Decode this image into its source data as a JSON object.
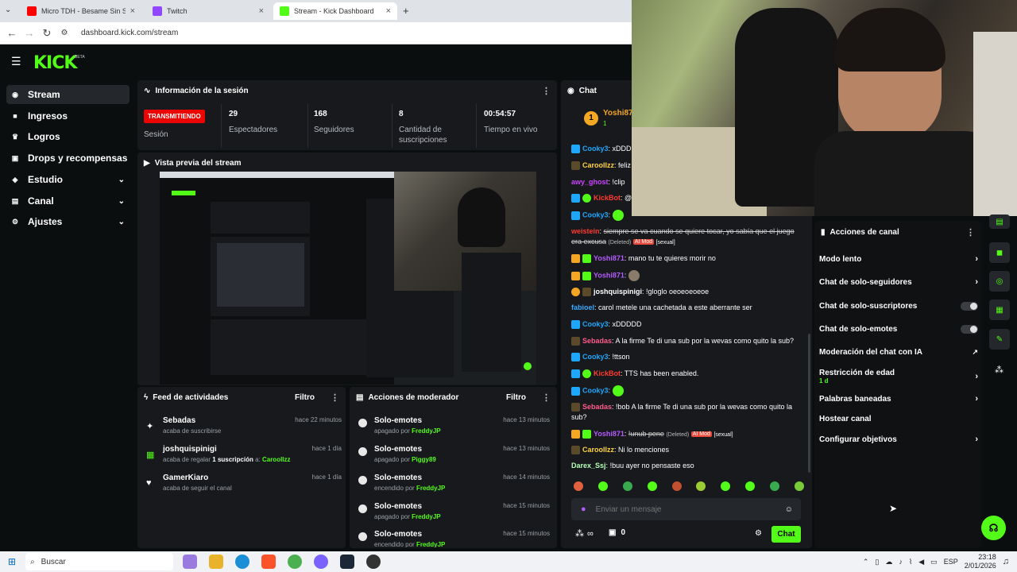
{
  "browser": {
    "tabs": [
      {
        "title": "Micro TDH - Besame Sin Sentir",
        "color": "#ff0000"
      },
      {
        "title": "Twitch",
        "color": "#9146ff"
      },
      {
        "title": "Stream - Kick Dashboard",
        "color": "#53fc18"
      }
    ],
    "new_tab": "+",
    "url": "dashboard.kick.com/stream"
  },
  "kick": {
    "logo": "KICK",
    "beta": "BETA",
    "sidebar": [
      {
        "label": "Stream",
        "icon": "pulse-icon",
        "active": true
      },
      {
        "label": "Ingresos",
        "icon": "money-icon"
      },
      {
        "label": "Logros",
        "icon": "trophy-icon"
      },
      {
        "label": "Drops y recompensas",
        "icon": "gift-icon"
      },
      {
        "label": "Estudio",
        "icon": "studio-icon",
        "expandable": true
      },
      {
        "label": "Canal",
        "icon": "channel-icon",
        "expandable": true
      },
      {
        "label": "Ajustes",
        "icon": "gear-icon",
        "expandable": true
      }
    ]
  },
  "session": {
    "title": "Información de la sesión",
    "live_badge": "TRANSMITIENDO",
    "session_label": "Sesión",
    "stats": [
      {
        "value": "29",
        "label": "Espectadores"
      },
      {
        "value": "168",
        "label": "Seguidores"
      },
      {
        "value": "8",
        "label": "Cantidad de suscripciones"
      },
      {
        "value": "00:54:57",
        "label": "Tiempo en vivo"
      }
    ]
  },
  "preview": {
    "title": "Vista previa del stream"
  },
  "activity": {
    "title": "Feed de actividades",
    "filter": "Filtro",
    "items": [
      {
        "name": "Sebadas",
        "desc": "acaba de suscribirse",
        "time": "hace 22 minutos",
        "icon": "sparkle-icon"
      },
      {
        "name": "joshquispinigi",
        "desc": "acaba de regalar ",
        "desc_bold": "1 suscripción",
        "desc_end": " a: ",
        "target": "Caroollzz",
        "time": "hace 1 día",
        "icon": "gift-sub-icon"
      },
      {
        "name": "GamerKiaro",
        "desc": "acaba de seguir el canal",
        "time": "hace 1 día",
        "icon": "heart-icon"
      }
    ]
  },
  "mod": {
    "title": "Acciones de moderador",
    "filter": "Filtro",
    "items": [
      {
        "name": "Solo-emotes",
        "state": "apagado por ",
        "mod": "FreddyJP",
        "time": "hace 13 minutos"
      },
      {
        "name": "Solo-emotes",
        "state": "apagado por ",
        "mod": "Piggy89",
        "time": "hace 13 minutos"
      },
      {
        "name": "Solo-emotes",
        "state": "encendido por ",
        "mod": "FreddyJP",
        "time": "hace 14 minutos"
      },
      {
        "name": "Solo-emotes",
        "state": "apagado por ",
        "mod": "FreddyJP",
        "time": "hace 15 minutos"
      },
      {
        "name": "Solo-emotes",
        "state": "encendido por ",
        "mod": "FreddyJP",
        "time": "hace 15 minutos"
      }
    ]
  },
  "chat": {
    "title": "Chat",
    "pinned_user": "Yoshi87",
    "pinned_count": "1",
    "messages": [
      {
        "user": "Cooky3",
        "color": "#1ea7ff",
        "text": "xDDDD"
      },
      {
        "user": "Caroollzz",
        "color": "#ffd43b",
        "text": "feliz"
      },
      {
        "user": "awy_ghost",
        "color": "#cc44ff",
        "text": "!clip"
      },
      {
        "user": "KickBot",
        "color": "#ff3b30",
        "text": "@"
      },
      {
        "user": "Cooky3",
        "color": "#1ea7ff",
        "text": ""
      },
      {
        "user": "weistein",
        "color": "#ff3b30",
        "text": "siempre se va cuando se quiere tocar, yo sabía que el juego era excusa",
        "deleted": "(Deleted)",
        "ai": "AI Mod",
        "reason": "[sexual]"
      },
      {
        "user": "Yoshi871",
        "color": "#b45cff",
        "text": "mano tu te quieres morir no"
      },
      {
        "user": "Yoshi871",
        "color": "#b45cff",
        "text": ""
      },
      {
        "user": "joshquispinigi",
        "color": "#ffffff",
        "text": "!gloglo oeoeoeoeoe"
      },
      {
        "user": "fabioel",
        "color": "#3aa9ff",
        "text": "carol metele una cachetada a este aberrante ser"
      },
      {
        "user": "Cooky3",
        "color": "#1ea7ff",
        "text": "xDDDDD"
      },
      {
        "user": "Sebadas",
        "color": "#ff5c8a",
        "text": "A la firme Te di una sub por la wevas como quito la sub?"
      },
      {
        "user": "Cooky3",
        "color": "#1ea7ff",
        "text": "!ttson"
      },
      {
        "user": "KickBot",
        "color": "#ff3b30",
        "text": "TTS has been enabled."
      },
      {
        "user": "Cooky3",
        "color": "#1ea7ff",
        "text": ""
      },
      {
        "user": "Sebadas",
        "color": "#ff5c8a",
        "text": "!bob A la firme Te di una sub por la wevas como quito la sub?"
      },
      {
        "user": "Yoshi871",
        "color": "#b45cff",
        "text": "!unub pene",
        "deleted": "(Deleted)",
        "ai": "AI Mod",
        "reason": "[sexual]"
      },
      {
        "user": "Caroollzz",
        "color": "#ffd43b",
        "text": "Ni lo menciones"
      },
      {
        "user": "Darex_Ssj",
        "color": "#b7ffb7",
        "text": "!buu ayer no pensaste eso"
      }
    ],
    "input_placeholder": "Enviar un mensaje",
    "points": "∞",
    "gifts": "0",
    "send": "Chat"
  },
  "channel_actions": {
    "title": "Acciones de canal",
    "items": [
      {
        "label": "Modo lento",
        "type": "arrow"
      },
      {
        "label": "Chat de solo-seguidores",
        "type": "arrow"
      },
      {
        "label": "Chat de solo-suscriptores",
        "type": "toggle"
      },
      {
        "label": "Chat de solo-emotes",
        "type": "toggle"
      },
      {
        "label": "Moderación del chat con IA",
        "type": "external"
      },
      {
        "label": "Restricción de edad",
        "sub": "1 d",
        "type": "arrow"
      },
      {
        "label": "Palabras baneadas",
        "type": "arrow"
      },
      {
        "label": "Hostear canal",
        "type": "none"
      },
      {
        "label": "Configurar objetivos",
        "type": "arrow"
      }
    ]
  },
  "taskbar": {
    "search": "Buscar",
    "lang": "ESP",
    "time": "23:18",
    "date": "2/01/2026"
  },
  "colors": {
    "accent": "#53fc18",
    "live": "#eb0400",
    "panel": "#17191c"
  }
}
